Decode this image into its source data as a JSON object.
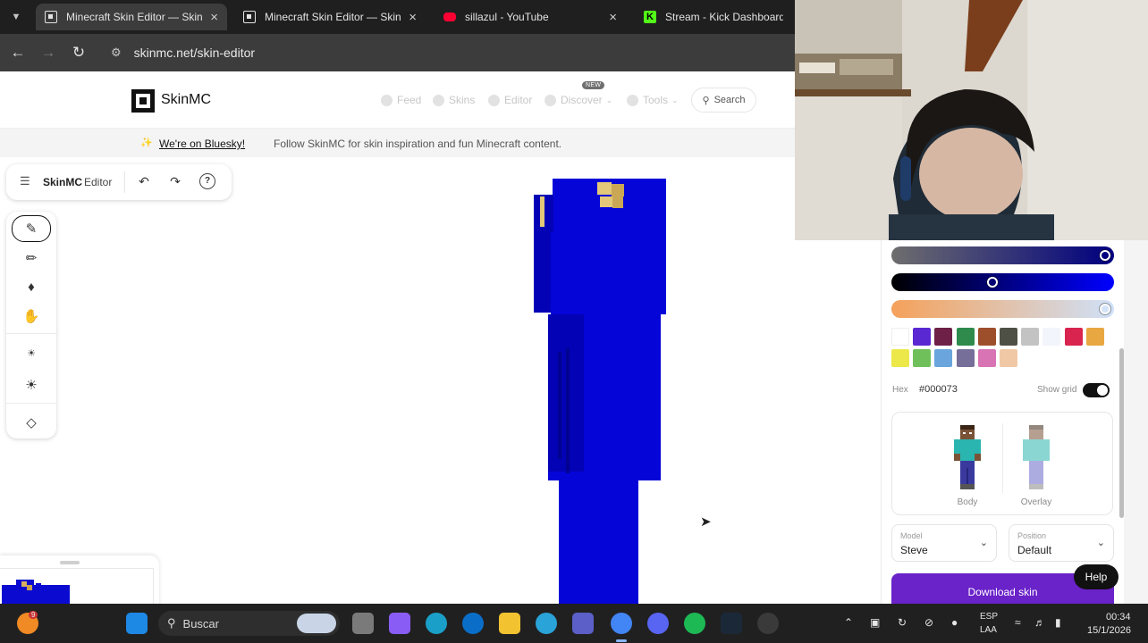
{
  "browser": {
    "tabs": [
      {
        "title": "Minecraft Skin Editor — SkinMC",
        "active": true
      },
      {
        "title": "Minecraft Skin Editor — SkinMC",
        "active": false
      },
      {
        "title": "sillazul - YouTube",
        "active": false
      },
      {
        "title": "Stream - Kick Dashboard",
        "active": false
      }
    ],
    "url": "skinmc.net/skin-editor"
  },
  "site": {
    "logo": "SkinMC",
    "nav": [
      "Feed",
      "Skins",
      "Editor",
      "Discover",
      "Tools"
    ],
    "new_badge": "NEW",
    "search": "Search",
    "announcement_link": "We're on Bluesky!",
    "announcement_text": "Follow SkinMC for skin inspiration and fun Minecraft content."
  },
  "editor": {
    "brand": "SkinMC",
    "brand_suffix": "Editor",
    "tools": [
      "pen-tool-icon",
      "eyedropper-icon",
      "bucket-icon",
      "hand-icon",
      "darken-icon",
      "lighten-icon",
      "eraser-icon"
    ]
  },
  "panel": {
    "sliders": [
      {
        "name": "lightness",
        "value": 1.0
      },
      {
        "name": "saturation",
        "value": 0.45
      },
      {
        "name": "alpha",
        "value": 1.0
      }
    ],
    "swatches": [
      "#ffffff",
      "#5a28d2",
      "#6e2047",
      "#2e8b4c",
      "#9d4f2c",
      "#4f5045",
      "#c3c3c3",
      "#f2f5fb",
      "#d8244e",
      "#e9a741",
      "#ece84a",
      "#6fc05a",
      "#6aa6dd",
      "#756f9a",
      "#d874b4",
      "#f1c8a6"
    ],
    "hex_label": "Hex",
    "hex_value": "#000073",
    "show_grid_label": "Show grid",
    "show_grid": true,
    "layers": [
      {
        "label": "Body"
      },
      {
        "label": "Overlay"
      }
    ],
    "model_caption": "Model",
    "model_value": "Steve",
    "position_caption": "Position",
    "position_value": "Default",
    "download": "Download skin",
    "help": "Help"
  },
  "taskbar": {
    "search_placeholder": "Buscar",
    "notification_count": "9",
    "lang_1": "ESP",
    "lang_2": "LAA",
    "time": "00:34",
    "date": "15/1/2026"
  }
}
